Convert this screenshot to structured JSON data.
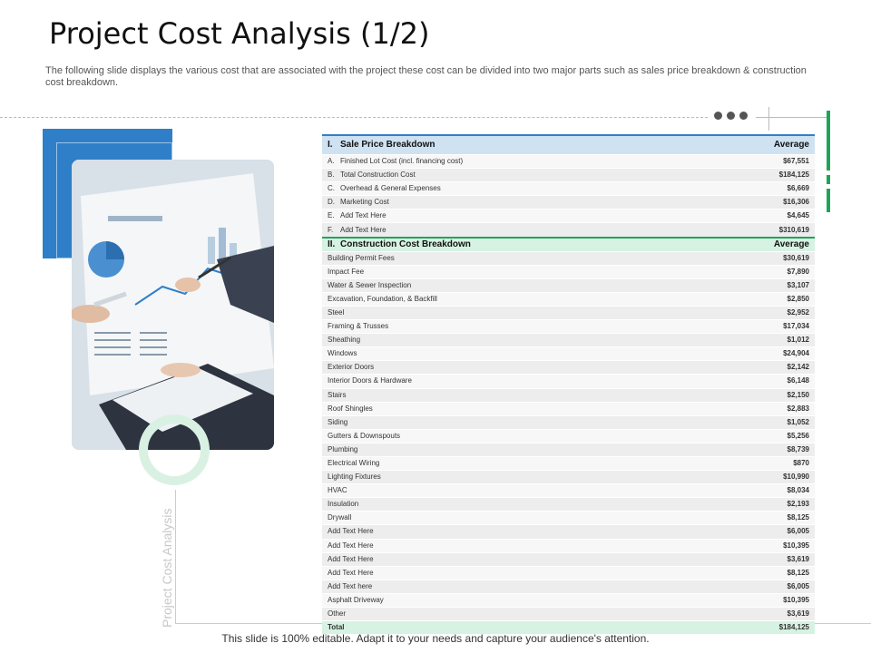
{
  "title": "Project Cost Analysis (1/2)",
  "subtitle": "The following slide displays the various cost that are associated with the project these cost can be divided into two major parts such as sales price breakdown & construction cost breakdown.",
  "side_label": "Project Cost Analysis",
  "footer": "This slide is 100% editable. Adapt it to your needs and capture your audience's attention.",
  "colors": {
    "accent_blue": "#2f7fc8",
    "accent_green": "#1fa45a"
  },
  "sale": {
    "index": "I.",
    "header": "Sale Price Breakdown",
    "avg_label": "Average",
    "rows": [
      {
        "idx": "A.",
        "label": "Finished Lot Cost (incl. financing cost)",
        "value": "$67,551"
      },
      {
        "idx": "B.",
        "label": "Total Construction Cost",
        "value": "$184,125"
      },
      {
        "idx": "C.",
        "label": "Overhead & General Expenses",
        "value": "$6,669"
      },
      {
        "idx": "D.",
        "label": "Marketing Cost",
        "value": "$16,306"
      },
      {
        "idx": "E.",
        "label": "Add Text Here",
        "value": "$4,645"
      },
      {
        "idx": "F.",
        "label": "Add Text Here",
        "value": "$310,619"
      }
    ]
  },
  "construction": {
    "index": "II.",
    "header": "Construction Cost Breakdown",
    "avg_label": "Average",
    "rows": [
      {
        "label": "Building Permit Fees",
        "value": "$30,619"
      },
      {
        "label": "Impact Fee",
        "value": "$7,890"
      },
      {
        "label": "Water & Sewer Inspection",
        "value": "$3,107"
      },
      {
        "label": "Excavation, Foundation, & Backfill",
        "value": "$2,850"
      },
      {
        "label": "Steel",
        "value": "$2,952"
      },
      {
        "label": "Framing & Trusses",
        "value": "$17,034"
      },
      {
        "label": "Sheathing",
        "value": "$1,012"
      },
      {
        "label": "Windows",
        "value": "$24,904"
      },
      {
        "label": "Exterior Doors",
        "value": "$2,142"
      },
      {
        "label": "Interior Doors & Hardware",
        "value": "$6,148"
      },
      {
        "label": "Stairs",
        "value": "$2,150"
      },
      {
        "label": "Roof Shingles",
        "value": "$2,883"
      },
      {
        "label": "Siding",
        "value": "$1,052"
      },
      {
        "label": "Gutters & Downspouts",
        "value": "$5,256"
      },
      {
        "label": "Plumbing",
        "value": "$8,739"
      },
      {
        "label": "Electrical Wiring",
        "value": "$870"
      },
      {
        "label": "Lighting Fixtures",
        "value": "$10,990"
      },
      {
        "label": "HVAC",
        "value": "$8,034"
      },
      {
        "label": "Insulation",
        "value": "$2,193"
      },
      {
        "label": "Drywall",
        "value": "$8,125"
      },
      {
        "label": "Add Text Here",
        "value": "$6,005"
      },
      {
        "label": "Add Text Here",
        "value": "$10,395"
      },
      {
        "label": "Add Text Here",
        "value": "$3,619"
      },
      {
        "label": "Add Text Here",
        "value": "$8,125"
      },
      {
        "label": "Add Text here",
        "value": "$6,005"
      },
      {
        "label": "Asphalt Driveway",
        "value": "$10,395"
      },
      {
        "label": "Other",
        "value": "$3,619"
      }
    ],
    "total_label": "Total",
    "total_value": "$184,125"
  }
}
